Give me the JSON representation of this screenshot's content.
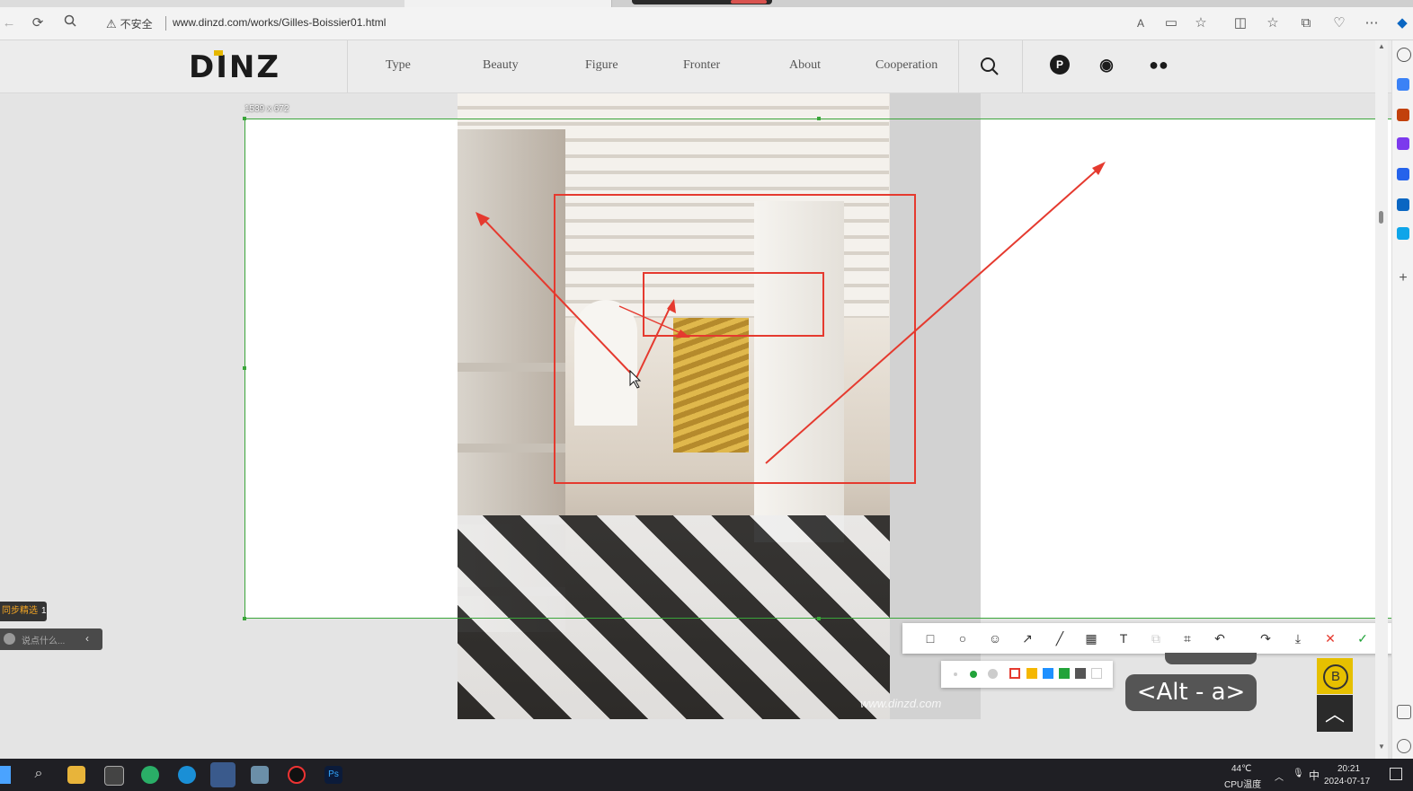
{
  "browser": {
    "security_label": "不安全",
    "url": "www.dinzd.com/works/Gilles-Boissier01.html"
  },
  "site": {
    "logo": "DINZ",
    "nav": [
      "Type",
      "Beauty",
      "Figure",
      "Fronter",
      "About",
      "Cooperation"
    ],
    "social": [
      "pinterest-icon",
      "weibo-icon",
      "wechat-icon"
    ]
  },
  "photo": {
    "watermark": "www.dinzd.com"
  },
  "capture": {
    "dimensions": "1539 x 672",
    "annotation_color": "#e53a2f",
    "selection_color": "#3aa53a",
    "tools": [
      "rectangle-tool-icon",
      "ellipse-tool-icon",
      "emoji-tool-icon",
      "arrow-tool-icon",
      "line-tool-icon",
      "mosaic-tool-icon",
      "text-tool-icon",
      "copy-tool-icon",
      "ocr-tool-icon",
      "undo-icon",
      "redo-icon",
      "save-icon",
      "cancel-icon",
      "confirm-icon"
    ],
    "palette": [
      "#e53a2f",
      "#f5b700",
      "#1e90ff",
      "#22a33a",
      "#555555",
      "#ffffff"
    ],
    "selected_color": "#e53a2f",
    "selected_size": "large"
  },
  "overlay": {
    "shortcut": "<Alt - a>",
    "chat_badge": "同步精选",
    "chat_count": "1",
    "chat_placeholder": "说点什么..."
  },
  "taskbar": {
    "temperature": "44℃",
    "temperature_label": "CPU温度",
    "ime": "中",
    "time": "20:21",
    "date": "2024-07-17"
  }
}
